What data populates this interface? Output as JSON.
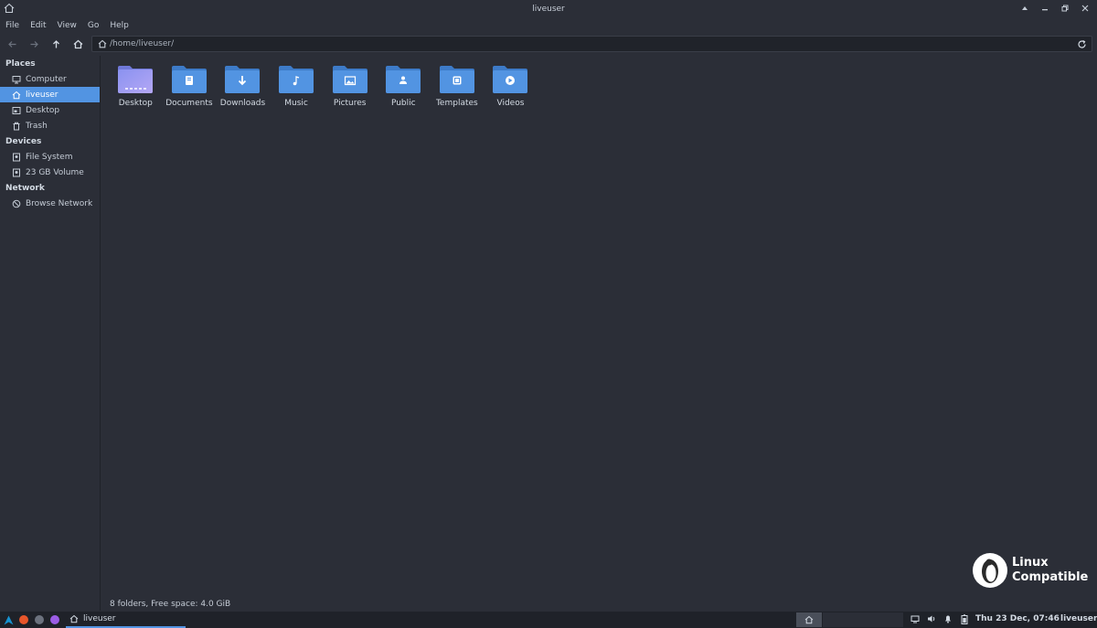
{
  "window": {
    "title": "liveuser"
  },
  "menu": [
    "File",
    "Edit",
    "View",
    "Go",
    "Help"
  ],
  "location": {
    "path": "/home/liveuser/"
  },
  "sidebar": {
    "places_heading": "Places",
    "places": [
      {
        "label": "Computer",
        "icon": "computer-icon"
      },
      {
        "label": "liveuser",
        "icon": "home-icon",
        "active": true
      },
      {
        "label": "Desktop",
        "icon": "desktop-icon"
      },
      {
        "label": "Trash",
        "icon": "trash-icon"
      }
    ],
    "devices_heading": "Devices",
    "devices": [
      {
        "label": "File System",
        "icon": "drive-icon"
      },
      {
        "label": "23 GB Volume",
        "icon": "drive-icon"
      }
    ],
    "network_heading": "Network",
    "network": [
      {
        "label": "Browse Network",
        "icon": "network-icon"
      }
    ]
  },
  "folders": [
    {
      "label": "Desktop",
      "icon": "desktop-folder-icon"
    },
    {
      "label": "Documents",
      "icon": "documents-folder-icon"
    },
    {
      "label": "Downloads",
      "icon": "downloads-folder-icon"
    },
    {
      "label": "Music",
      "icon": "music-folder-icon"
    },
    {
      "label": "Pictures",
      "icon": "pictures-folder-icon"
    },
    {
      "label": "Public",
      "icon": "public-folder-icon"
    },
    {
      "label": "Templates",
      "icon": "templates-folder-icon"
    },
    {
      "label": "Videos",
      "icon": "videos-folder-icon"
    }
  ],
  "status": {
    "text": "8 folders, Free space: 4.0 GiB"
  },
  "watermark": {
    "line1": "Linux",
    "line2": "Compatible"
  },
  "taskbar": {
    "task_label": "liveuser",
    "clock": "Thu 23 Dec, 07:46",
    "user": "liveuser"
  },
  "colors": {
    "accent": "#5294e2",
    "background": "#2b2e37",
    "folder": "#5294e2"
  }
}
